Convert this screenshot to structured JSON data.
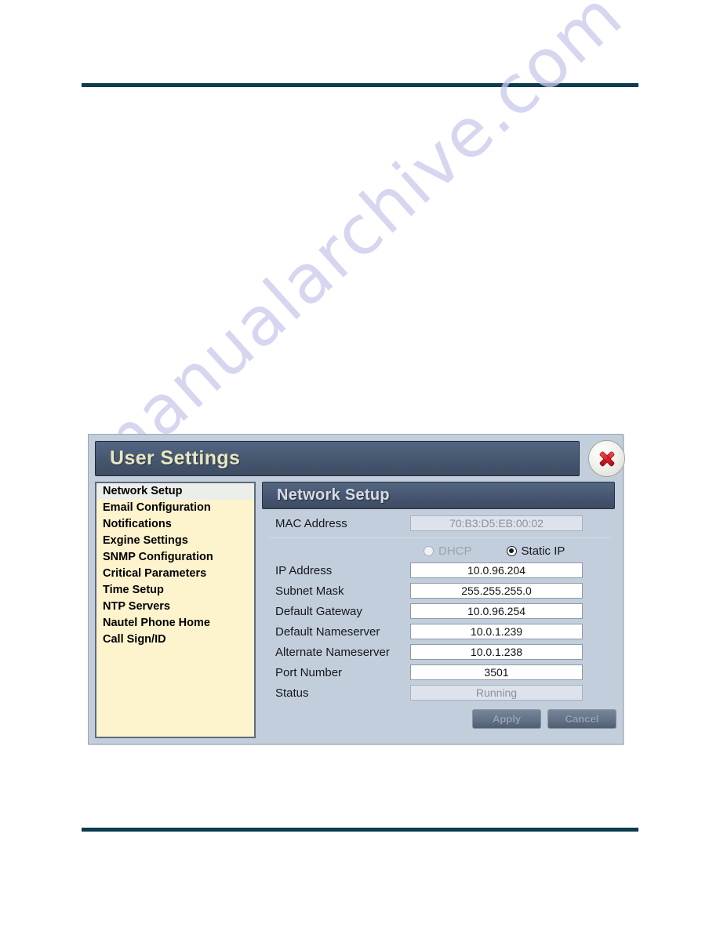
{
  "document": {
    "watermark": "manualarchive.com"
  },
  "dialog": {
    "title": "User Settings",
    "close_icon": "close-x-icon"
  },
  "sidebar": {
    "items": [
      {
        "label": "Network Setup",
        "selected": true
      },
      {
        "label": "Email Configuration",
        "selected": false
      },
      {
        "label": "Notifications",
        "selected": false
      },
      {
        "label": "Exgine Settings",
        "selected": false
      },
      {
        "label": "SNMP Configuration",
        "selected": false
      },
      {
        "label": "Critical Parameters",
        "selected": false
      },
      {
        "label": "Time Setup",
        "selected": false
      },
      {
        "label": "NTP Servers",
        "selected": false
      },
      {
        "label": "Nautel Phone Home",
        "selected": false
      },
      {
        "label": "Call Sign/ID",
        "selected": false
      }
    ]
  },
  "panel": {
    "header": "Network Setup",
    "mac": {
      "label": "MAC Address",
      "value": "70:B3:D5:EB:00:02"
    },
    "mode": {
      "dhcp_label": "DHCP",
      "dhcp_selected": false,
      "static_label": "Static IP",
      "static_selected": true
    },
    "fields": [
      {
        "label": "IP Address",
        "value": "10.0.96.204"
      },
      {
        "label": "Subnet Mask",
        "value": "255.255.255.0"
      },
      {
        "label": "Default Gateway",
        "value": "10.0.96.254"
      },
      {
        "label": "Default Nameserver",
        "value": "10.0.1.239"
      },
      {
        "label": "Alternate Nameserver",
        "value": "10.0.1.238"
      },
      {
        "label": "Port Number",
        "value": "3501"
      }
    ],
    "status": {
      "label": "Status",
      "value": "Running"
    },
    "buttons": {
      "apply": "Apply",
      "cancel": "Cancel"
    }
  },
  "colors": {
    "rule": "#0b3c4f",
    "dialog_bg": "#c3cedd",
    "titlebar": "#46566f",
    "title_text": "#e7e7c2",
    "sidebar_bg": "#fdf3cd",
    "close_red": "#d61f26",
    "watermark": "#c9c9ec"
  }
}
